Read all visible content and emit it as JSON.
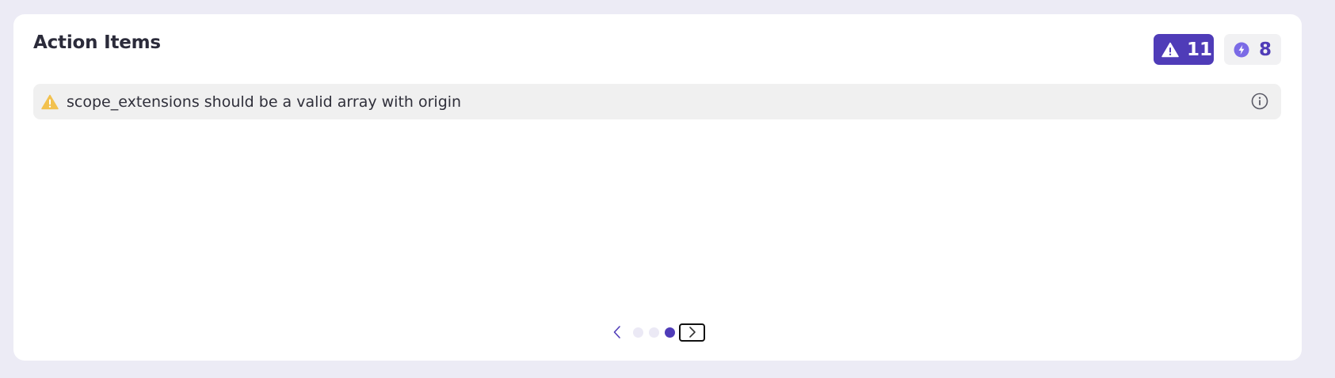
{
  "header": {
    "title": "Action Items"
  },
  "badges": {
    "warnings": {
      "icon": "warning-triangle-icon",
      "count": "11",
      "color": "#4f3cb8"
    },
    "suggestions": {
      "icon": "lightning-icon",
      "count": "8",
      "color": "#4f3cb8"
    }
  },
  "items": [
    {
      "icon": "warning-icon",
      "text": "scope_extensions should be a valid array with origin",
      "action_icon": "info-icon"
    }
  ],
  "pagination": {
    "pages": 3,
    "current_page": 3,
    "prev_icon": "chevron-left-icon",
    "next_icon": "chevron-right-icon"
  }
}
